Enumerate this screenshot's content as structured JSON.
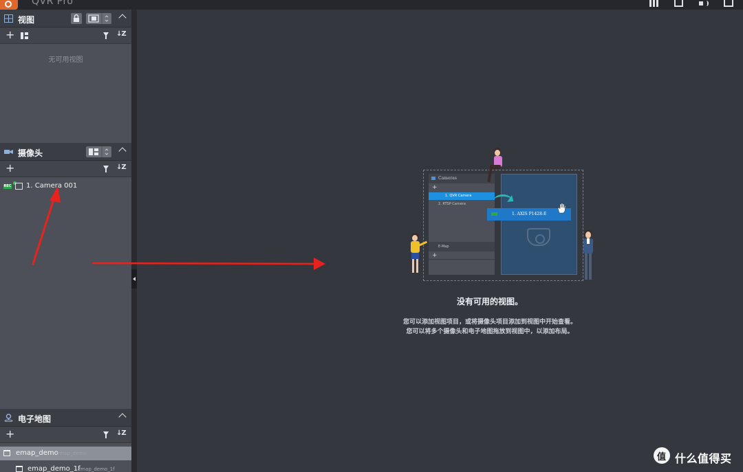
{
  "app": {
    "title": "QVR Pro"
  },
  "views_section": {
    "title": "视图",
    "empty_text": "无可用视图"
  },
  "cameras_section": {
    "title": "摄像头",
    "items": [
      {
        "rec_badge": "REC",
        "label": "1. Camera 001"
      }
    ]
  },
  "emap_section": {
    "title": "电子地图",
    "items": [
      {
        "label": "emap_demo",
        "sub": "emap_demo"
      },
      {
        "label": "emap_demo_1f",
        "sub": "emap_demo_1f"
      }
    ]
  },
  "illustration": {
    "panel_title": "Cameras",
    "row_selected": "1. QVR Camera",
    "row_other": "2. RTSP Camera",
    "sub_title": "E-Map",
    "drag_label": "1. AXIS P1428-E"
  },
  "main": {
    "empty_title": "没有可用的视图。",
    "empty_line1": "您可以添加视图项目，或将摄像头项目添加到视图中开始查看。",
    "empty_line2": "您可以将多个摄像头和电子地图拖放到视图中，以添加布局。"
  },
  "watermark": {
    "text": "什么值得买"
  },
  "colors": {
    "sidebar_bg": "#4d5058",
    "main_bg": "#34373e",
    "rec_green": "#2aa84a",
    "annotation_red": "#e8231e",
    "illustration_blue": "#2f4f70"
  }
}
